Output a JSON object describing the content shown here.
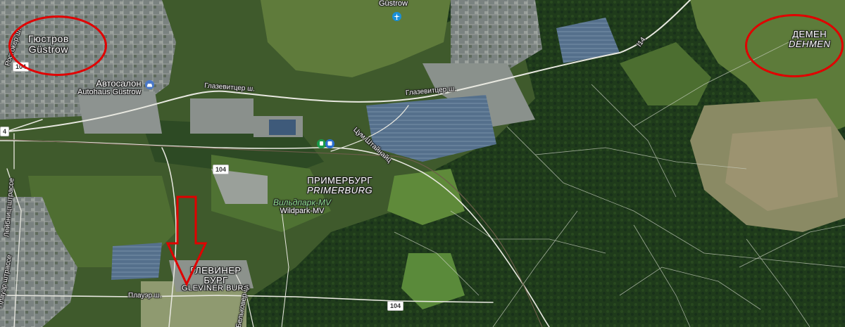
{
  "map": {
    "places": {
      "guestrow_ru": "Гюстров",
      "guestrow_de": "Güstrow",
      "demen_ru": "ДЕМЕН",
      "demen_de": "DEHMEN",
      "primerburg_ru": "ПРИМЕРБУРГ",
      "primerburg_de": "PRIMERBURG",
      "gleviner_ru_1": "ГЛЕВИНЕР",
      "gleviner_ru_2": "БУРГ",
      "gleviner_de": "GLEVINER BURG"
    },
    "pois": {
      "autosalon_ru": "Автосалон",
      "autosalon_de": "Autohaus Güstrow",
      "airfield": "Güstrow",
      "wildpark_ru": "Вильдпарк-MV",
      "wildpark_de": "Wildpark-MV"
    },
    "roads": {
      "glasewitzer_1": "Глазевитцер ш.",
      "glasewitzer_2": "Глазевитцер ш.",
      "tsum_shtainaits": "Цум Штайнайц",
      "rostocker": "Ростокер ш.",
      "lebnitzstrasse": "Лейбництштрассе",
      "plauer_strasse": "Плауэр штрассе",
      "plauer_sh": "Плауэр ш.",
      "belkower": "Бельковер ш.",
      "l14": "l14"
    },
    "shields": {
      "b104_a": "104",
      "b104_b": "104",
      "b104_c": "104",
      "s4": "4"
    },
    "annotations": {
      "ellipse_color": "#e10000",
      "arrow_color": "#e10000",
      "circled_places": [
        "Güstrow",
        "DEHMEN"
      ],
      "arrow_target": "GLEVINER BURG"
    },
    "colors": {
      "forest": "#1d3a1a",
      "field": "#5b7a3a",
      "urban": "#7d8584",
      "solar": "#58708a"
    }
  }
}
